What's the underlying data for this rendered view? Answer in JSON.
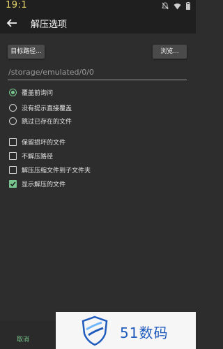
{
  "status_bar": {
    "time": "19:1"
  },
  "toolbar": {
    "title": "解压选项"
  },
  "target_button": "目标路径...",
  "browse_button": "浏览...",
  "path_value": "/storage/emulated/0/0",
  "overwrite_options": [
    {
      "label": "覆盖前询问",
      "selected": true
    },
    {
      "label": "没有提示直接覆盖",
      "selected": false
    },
    {
      "label": "跳过已存在的文件",
      "selected": false
    }
  ],
  "checkboxes": [
    {
      "label": "保留损坏的文件",
      "checked": false
    },
    {
      "label": "不解压路径",
      "checked": false
    },
    {
      "label": "解压压缩文件到子文件夹",
      "checked": false
    },
    {
      "label": "显示解压的文件",
      "checked": true
    }
  ],
  "bottom_bar": {
    "cancel_label": "取消"
  },
  "watermark": {
    "text": "51数码"
  },
  "colors": {
    "accent": "#78c58e",
    "background": "#2d2d2d",
    "bar": "#1f1f1f",
    "watermark_blue": "#1f5bbd"
  }
}
